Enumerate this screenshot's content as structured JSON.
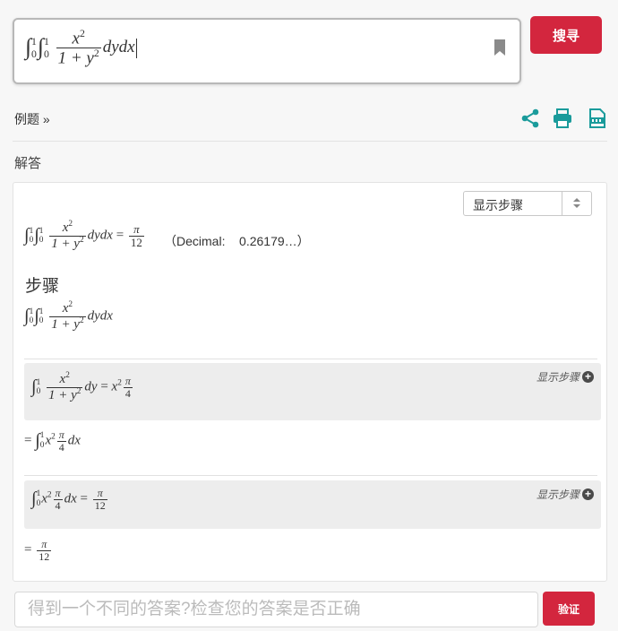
{
  "search": {
    "expression_integrand_numerator": "x",
    "expression_integrand_denominator_base": "1 + y",
    "expression_differentials": "dydx",
    "lower_limit": "0",
    "upper_limit": "1",
    "exponent": "2",
    "button_label": "搜寻"
  },
  "toolbar": {
    "examples_label": "例题",
    "examples_arrow": "»",
    "icons": [
      "share-icon",
      "print-icon",
      "pdf-icon"
    ]
  },
  "answer": {
    "section_label": "解答",
    "show_steps_select": "显示步骤",
    "result_value_num": "π",
    "result_value_den": "12",
    "decimal_label": "（Decimal:",
    "decimal_value": "0.26179…）",
    "steps_heading": "步骤",
    "step_links": [
      "显示步骤",
      "显示步骤"
    ],
    "step1_rhs_num": "π",
    "step1_rhs_den": "4",
    "step3_rhs_num": "π",
    "step3_rhs_den": "12"
  },
  "verify": {
    "placeholder": "得到一个不同的答案?检查您的答案是否正确",
    "button_label": "验证"
  },
  "colors": {
    "accent_red": "#d3263e",
    "icon_teal": "#1a9b9b"
  }
}
